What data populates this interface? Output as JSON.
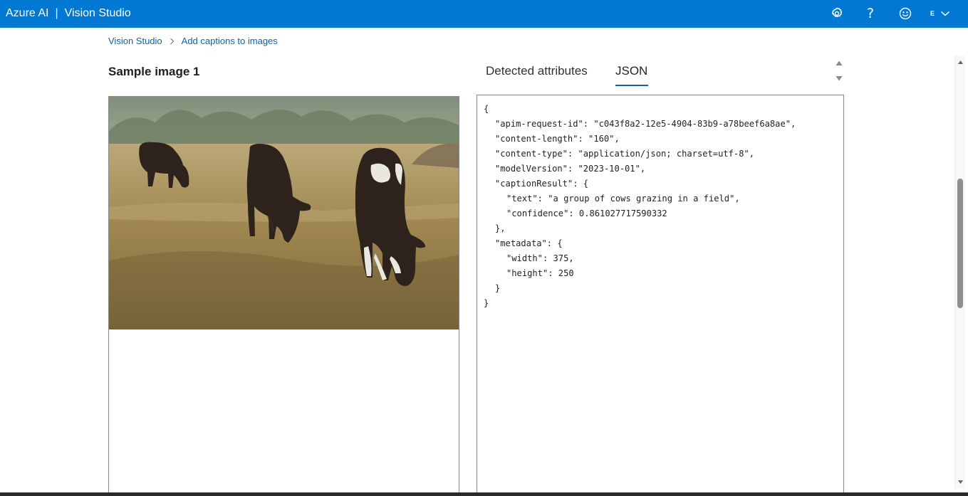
{
  "topbar": {
    "brand_name": "Azure AI",
    "separator": "|",
    "product_name": "Vision Studio",
    "account_initial": "E",
    "bg_color": "#0078d4"
  },
  "icons": {
    "settings": "gear-icon",
    "help": "question-mark-icon",
    "feedback": "smiley-icon",
    "account_menu": "chevron-down-icon",
    "help_glyph": "?"
  },
  "breadcrumb": {
    "items": [
      "Vision Studio",
      "Add captions to images"
    ]
  },
  "image_panel": {
    "title": "Sample image 1"
  },
  "result_tabs": {
    "items": [
      "Detected attributes",
      "JSON"
    ],
    "selected": "JSON",
    "accent_color": "#0f62a8"
  },
  "json_output": {
    "lines": [
      "{",
      "\"apim-request-id\": \"c043f8a2-12e5-4904-83b9-a78beef6a8ae\",",
      "\"content-length\": \"160\",",
      "\"content-type\": \"application/json; charset=utf-8\",",
      "\"modelVersion\": \"2023-10-01\",",
      "\"captionResult\": {",
      "\"text\": \"a group of cows grazing in a field\",",
      "\"confidence\": 0.861027717590332",
      "},",
      "\"metadata\": {",
      "\"width\": 375,",
      "\"height\": 250",
      "}",
      "}"
    ]
  }
}
